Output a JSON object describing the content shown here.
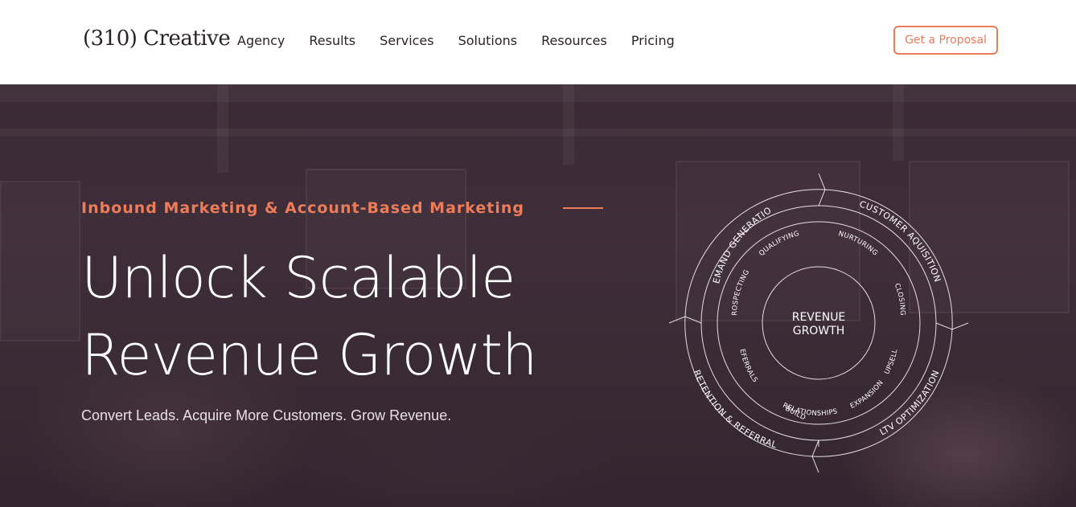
{
  "header": {
    "logo": "(310) Creative",
    "nav": [
      "Agency",
      "Results",
      "Services",
      "Solutions",
      "Resources",
      "Pricing"
    ],
    "cta_label": "Get a Proposal"
  },
  "hero": {
    "eyebrow": "Inbound Marketing & Account-Based Marketing",
    "headline_line1": "Unlock Scalable",
    "headline_line2": "Revenue Growth",
    "subheadline": "Convert Leads. Acquire More Customers. Grow Revenue."
  },
  "wheel": {
    "center_line1": "REVENUE",
    "center_line2": "GROWTH",
    "outer": [
      "DEMAND GENERATION",
      "CUSTOMER AQUISITION",
      "LTV OPTIMIZATION",
      "RETENTION & REFERRAL"
    ],
    "inner": [
      "QUALIFYING",
      "NURTURING",
      "CLOSING",
      "UPSELL",
      "EXPANSION",
      "BUILD",
      "RELATIONSHIPS",
      "REFERRALS",
      "PROSPECTING"
    ]
  },
  "colors": {
    "accent": "#ee7c58",
    "hero_bg": "#3a2a35"
  }
}
